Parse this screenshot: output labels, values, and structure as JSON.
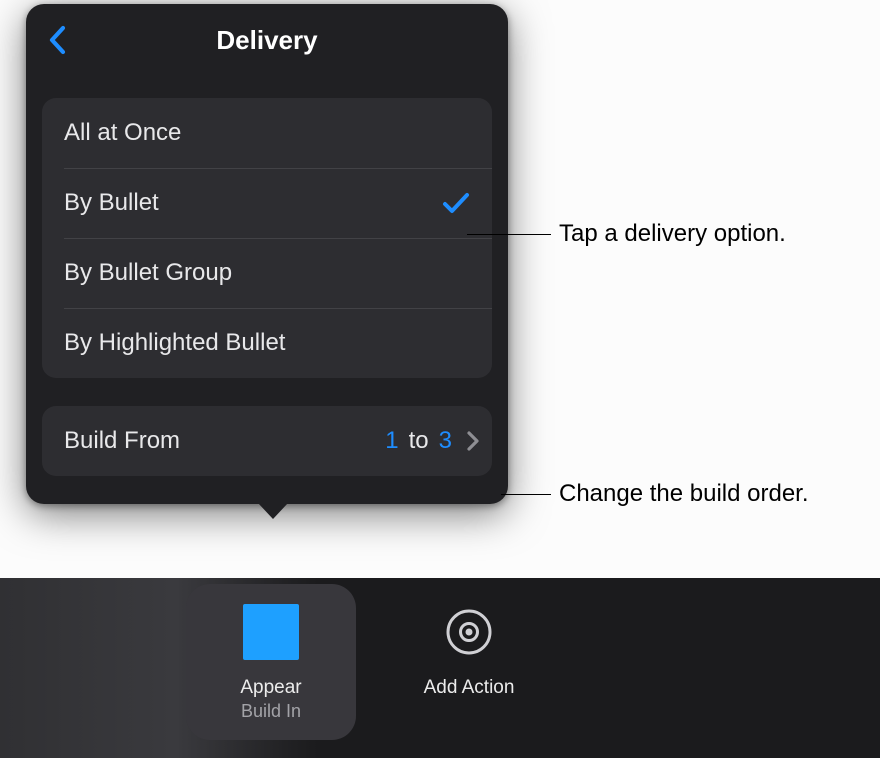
{
  "popover": {
    "title": "Delivery",
    "options": [
      {
        "label": "All at Once",
        "selected": false
      },
      {
        "label": "By Bullet",
        "selected": true
      },
      {
        "label": "By Bullet Group",
        "selected": false
      },
      {
        "label": "By Highlighted Bullet",
        "selected": false
      }
    ],
    "build": {
      "label": "Build From",
      "from": "1",
      "mid": "to",
      "to": "3"
    }
  },
  "effects": {
    "appear": {
      "title": "Appear",
      "subtitle": "Build In"
    },
    "addAction": {
      "title": "Add Action"
    }
  },
  "callouts": {
    "option": "Tap a delivery option.",
    "build": "Change the build order."
  },
  "colors": {
    "accent": "#1e8dff",
    "swatch": "#1ea0ff"
  }
}
